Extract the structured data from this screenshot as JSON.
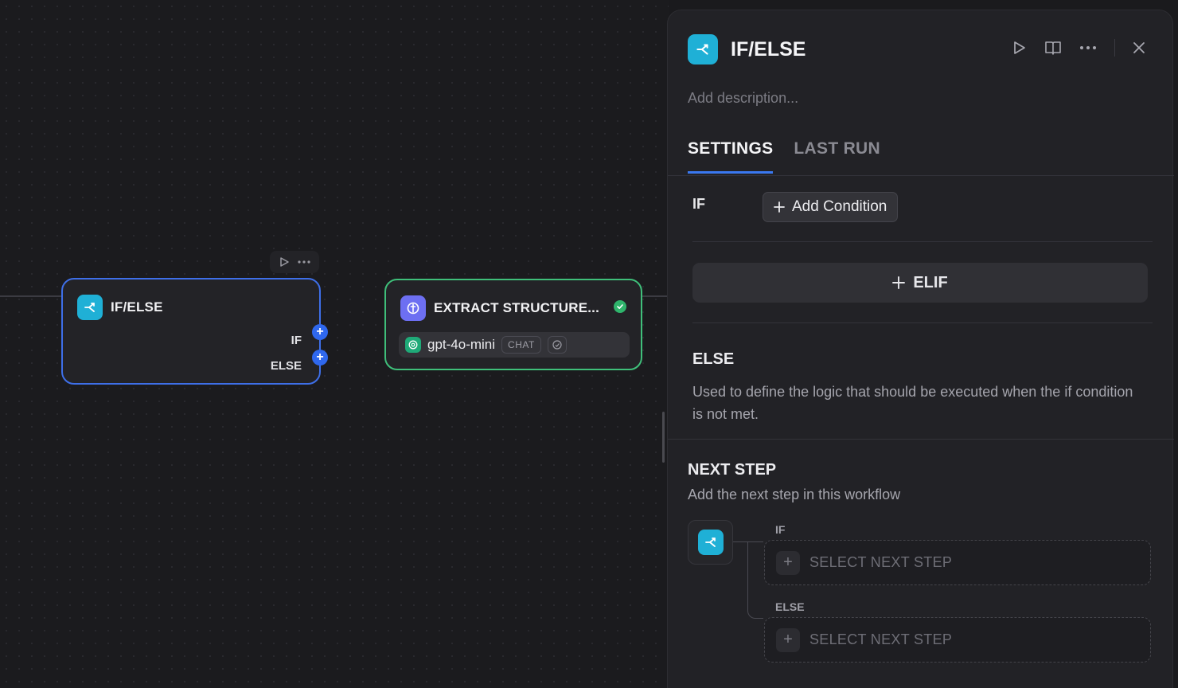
{
  "canvas": {
    "ifelse_node": {
      "title": "IF/ELSE",
      "if_label": "IF",
      "else_label": "ELSE"
    },
    "extract_node": {
      "title": "EXTRACT STRUCTURE...",
      "model": "gpt-4o-mini",
      "model_badge": "CHAT",
      "status": "success"
    }
  },
  "panel": {
    "title": "IF/ELSE",
    "description_placeholder": "Add description...",
    "tabs": [
      {
        "label": "SETTINGS",
        "active": true
      },
      {
        "label": "LAST RUN",
        "active": false
      }
    ],
    "if_label": "IF",
    "add_condition_label": "Add Condition",
    "elif_label": "ELIF",
    "else_title": "ELSE",
    "else_description": "Used to define the logic that should be executed when the if condition is not met.",
    "next_step": {
      "title": "NEXT STEP",
      "description": "Add the next step in this workflow",
      "branches": [
        {
          "label": "IF",
          "placeholder": "SELECT NEXT STEP"
        },
        {
          "label": "ELSE",
          "placeholder": "SELECT NEXT STEP"
        }
      ]
    }
  },
  "colors": {
    "accent_blue": "#3a78f0",
    "node_cyan": "#1fb0d6",
    "success_green": "#2fb56c",
    "extract_purple": "#6d6ff2"
  }
}
